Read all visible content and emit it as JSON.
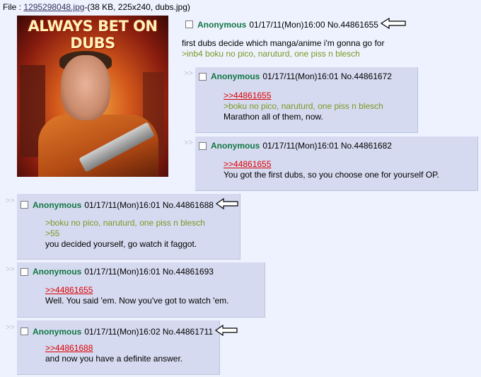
{
  "file": {
    "prefix": "File : ",
    "filename": "1295298048.jpg",
    "info": "-(38 KB, 225x240, dubs.jpg)"
  },
  "op_image": {
    "banner_text": "ALWAYS BET ON DUBS"
  },
  "op": {
    "name": "Anonymous",
    "meta": "01/17/11(Mon)16:00 No.44861655",
    "lines": [
      {
        "text": "first dubs decide which manga/anime i'm gonna go for",
        "kind": "text"
      },
      {
        "text": ">inb4 boku no pico, naruturd, one piss n blesch",
        "kind": "quote"
      }
    ]
  },
  "replies": [
    {
      "marker": ">>",
      "name": "Anonymous",
      "meta": "01/17/11(Mon)16:01 No.44861672",
      "lines": [
        {
          "text": ">>44861655",
          "kind": "ref"
        },
        {
          "text": ">boku no pico, naruturd, one piss n blesch",
          "kind": "quote"
        },
        {
          "text": "Marathon all of them, now.",
          "kind": "text"
        }
      ]
    },
    {
      "marker": ">>",
      "name": "Anonymous",
      "meta": "01/17/11(Mon)16:01 No.44861682",
      "lines": [
        {
          "text": ">>44861655",
          "kind": "ref"
        },
        {
          "text": "You got the first dubs, so you choose one for yourself OP.",
          "kind": "text"
        }
      ]
    },
    {
      "marker": ">>",
      "name": "Anonymous",
      "meta": "01/17/11(Mon)16:01 No.44861688",
      "lines": [
        {
          "text": ">boku no pico, naruturd, one piss n blesch",
          "kind": "quote"
        },
        {
          "text": ">55",
          "kind": "quote"
        },
        {
          "text": "you decided yourself, go watch it faggot.",
          "kind": "text"
        }
      ]
    },
    {
      "marker": ">>",
      "name": "Anonymous",
      "meta": "01/17/11(Mon)16:01 No.44861693",
      "lines": [
        {
          "text": ">>44861655",
          "kind": "ref"
        },
        {
          "text": "Well. You said 'em. Now you've got to watch 'em.",
          "kind": "text"
        }
      ]
    },
    {
      "marker": ">>",
      "name": "Anonymous",
      "meta": "01/17/11(Mon)16:02 No.44861711",
      "lines": [
        {
          "text": ">>44861688",
          "kind": "ref"
        },
        {
          "text": "and now you have a definite answer.",
          "kind": "text"
        }
      ]
    }
  ],
  "colors": {
    "background": "#eef2ff",
    "reply_bg": "#d6daf0",
    "name": "#117743",
    "quote": "#789922",
    "ref": "#dd0000"
  },
  "icons": {
    "highlight_arrow": "left-arrow-outline-icon"
  }
}
